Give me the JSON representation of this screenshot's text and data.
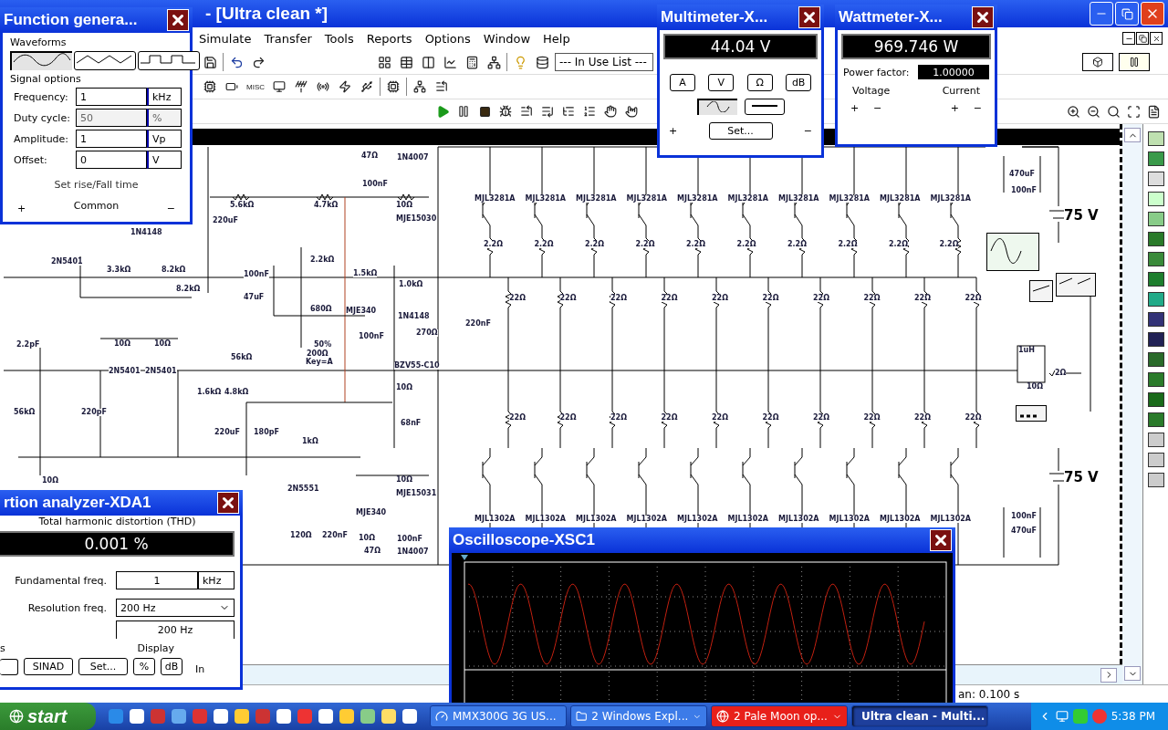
{
  "main_window": {
    "title": "- [Ultra clean *]"
  },
  "menu": [
    "Simulate",
    "Transfer",
    "Tools",
    "Reports",
    "Options",
    "Window",
    "Help"
  ],
  "toolbar": {
    "misc_label": "MISC",
    "component_list": "--- In Use List ---"
  },
  "schematic": {
    "labels": [
      "47Ω",
      "1N4007",
      "100nF",
      "5.6kΩ",
      "4.7kΩ",
      "10Ω",
      "220uF",
      "MJE15030",
      "1N4148",
      "2N5401",
      "3.3kΩ",
      "8.2kΩ",
      "8.2kΩ",
      "2.2kΩ",
      "1.5kΩ",
      "1.0kΩ",
      "100nF",
      "47uF",
      "680Ω",
      "MJE340",
      "1N4148",
      "220nF",
      "270Ω",
      "100nF",
      "50%",
      "200Ω",
      "Key=A",
      "BZV55-C10",
      "56kΩ",
      "2.2pF",
      "10Ω",
      "10Ω",
      "2N5401",
      "2N5401",
      "1.6kΩ",
      "4.8kΩ",
      "10Ω",
      "56kΩ",
      "220pF",
      "220uF",
      "180pF",
      "68nF",
      "1kΩ",
      "10Ω",
      "10Ω",
      "MJE15031",
      "2N5551",
      "MJE340",
      "120Ω",
      "220nF",
      "10Ω",
      "47Ω",
      "100nF",
      "1N4007",
      "470uF",
      "100nF",
      "1uH",
      "2Ω",
      "10Ω",
      "100nF",
      "470uF"
    ],
    "supplies": [
      "75 V",
      "75 V"
    ],
    "output_stage": [
      {
        "upper": "MJL3281A",
        "emitter": "2.2Ω",
        "upper_resistor": "22Ω",
        "lower_resistor": "22Ω",
        "lower": "MJL1302A"
      },
      {
        "upper": "MJL3281A",
        "emitter": "2.2Ω",
        "upper_resistor": "22Ω",
        "lower_resistor": "22Ω",
        "lower": "MJL1302A"
      },
      {
        "upper": "MJL3281A",
        "emitter": "2.2Ω",
        "upper_resistor": "22Ω",
        "lower_resistor": "22Ω",
        "lower": "MJL1302A"
      },
      {
        "upper": "MJL3281A",
        "emitter": "2.2Ω",
        "upper_resistor": "22Ω",
        "lower_resistor": "22Ω",
        "lower": "MJL1302A"
      },
      {
        "upper": "MJL3281A",
        "emitter": "2.2Ω",
        "upper_resistor": "22Ω",
        "lower_resistor": "22Ω",
        "lower": "MJL1302A"
      },
      {
        "upper": "MJL3281A",
        "emitter": "2.2Ω",
        "upper_resistor": "22Ω",
        "lower_resistor": "22Ω",
        "lower": "MJL1302A"
      },
      {
        "upper": "MJL3281A",
        "emitter": "2.2Ω",
        "upper_resistor": "22Ω",
        "lower_resistor": "22Ω",
        "lower": "MJL1302A"
      },
      {
        "upper": "MJL3281A",
        "emitter": "2.2Ω",
        "upper_resistor": "22Ω",
        "lower_resistor": "22Ω",
        "lower": "MJL1302A"
      },
      {
        "upper": "MJL3281A",
        "emitter": "2.2Ω",
        "upper_resistor": "22Ω",
        "lower_resistor": "22Ω",
        "lower": "MJL1302A"
      },
      {
        "upper": "MJL3281A",
        "emitter": "2.2Ω",
        "upper_resistor": "22Ω",
        "lower_resistor": "22Ω",
        "lower": "MJL1302A"
      }
    ]
  },
  "status_bar": {
    "text": "an: 0.100 s"
  },
  "function_generator": {
    "title": "Function genera...",
    "waveforms_label": "Waveforms",
    "waveforms": [
      {
        "kind": "sine",
        "selected": true
      },
      {
        "kind": "triangle",
        "selected": false
      },
      {
        "kind": "square",
        "selected": false
      }
    ],
    "signal_options_label": "Signal options",
    "fields": [
      {
        "label": "Frequency:",
        "value": "1",
        "unit": "kHz",
        "disabled": false
      },
      {
        "label": "Duty cycle:",
        "value": "50",
        "unit": "%",
        "disabled": true
      },
      {
        "label": "Amplitude:",
        "value": "1",
        "unit": "Vp",
        "disabled": false
      },
      {
        "label": "Offset:",
        "value": "0",
        "unit": "V",
        "disabled": false
      }
    ],
    "rise_fall_button": "Set rise/Fall time",
    "terminals": [
      "+",
      "Common",
      "−"
    ]
  },
  "multimeter": {
    "title": "Multimeter-X...",
    "display": "44.04 V",
    "modes": [
      "A",
      "V",
      "Ω",
      "dB"
    ],
    "signal_types": [
      {
        "kind": "ac",
        "selected": true
      },
      {
        "kind": "dc",
        "selected": false
      }
    ],
    "plus": "+",
    "set_button": "Set...",
    "minus": "−"
  },
  "wattmeter": {
    "title": "Wattmeter-X...",
    "display": "969.746 W",
    "power_factor_label": "Power factor:",
    "power_factor": "1.00000",
    "voltage_label": "Voltage",
    "current_label": "Current",
    "terminals": [
      "+",
      "−",
      "+",
      "−"
    ]
  },
  "distortion_analyzer": {
    "title": "rtion analyzer-XDA1",
    "thd_label": "Total harmonic distortion (THD)",
    "display": "0.001 %",
    "fundamental_label": "Fundamental freq.",
    "fundamental_value": "1",
    "fundamental_unit": "kHz",
    "resolution_label": "Resolution freq.",
    "resolution_select": "200 Hz",
    "resolution_value": "200 Hz",
    "controls_label": "s",
    "display_label": "Display",
    "buttons": [
      "SINAD",
      "Set..."
    ],
    "display_buttons": [
      "%",
      "dB"
    ],
    "input_label": "In"
  },
  "oscilloscope": {
    "title": "Oscilloscope-XSC1"
  },
  "taskbar": {
    "start": "start",
    "tasks": [
      {
        "label": "MMX300G 3G US...",
        "selected": false,
        "flashing": false,
        "group": false
      },
      {
        "label": "2 Windows Expl...",
        "selected": false,
        "flashing": false,
        "group": true
      },
      {
        "label": "2 Pale Moon op...",
        "selected": false,
        "flashing": true,
        "group": true
      },
      {
        "label": "Ultra clean - Multi...",
        "selected": true,
        "flashing": false,
        "group": false
      }
    ],
    "clock": "5:38 PM"
  }
}
